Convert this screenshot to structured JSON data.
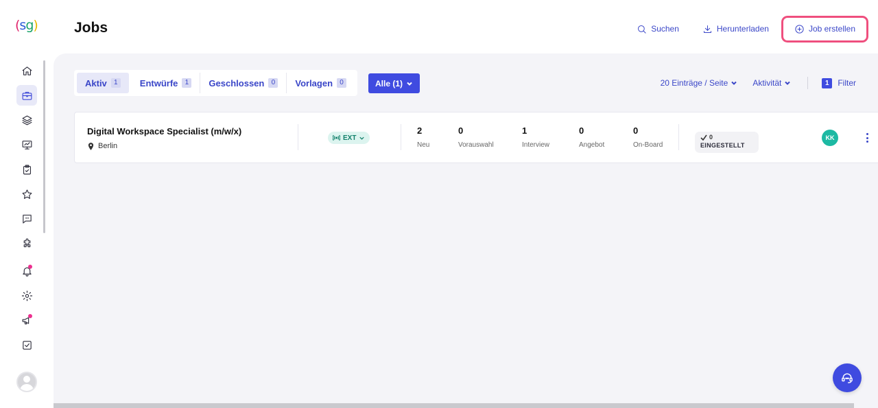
{
  "app": {
    "logo_text": "(sg)"
  },
  "header": {
    "title": "Jobs",
    "actions": {
      "search": "Suchen",
      "download": "Herunterladen",
      "create": "Job erstellen"
    }
  },
  "sidebar": {
    "items": [
      {
        "name": "home-icon"
      },
      {
        "name": "briefcase-icon",
        "active": true
      },
      {
        "name": "layers-icon"
      },
      {
        "name": "presentation-icon"
      },
      {
        "name": "clipboard-check-icon"
      },
      {
        "name": "star-icon"
      },
      {
        "name": "message-quote-icon"
      },
      {
        "name": "puzzle-icon"
      },
      {
        "name": "bell-icon",
        "notification": true
      },
      {
        "name": "gear-icon"
      },
      {
        "name": "megaphone-icon",
        "notification": true
      },
      {
        "name": "checkbox-icon"
      }
    ]
  },
  "tabs": [
    {
      "label": "Aktiv",
      "count": "1",
      "active": true
    },
    {
      "label": "Entwürfe",
      "count": "1"
    },
    {
      "label": "Geschlossen",
      "count": "0"
    },
    {
      "label": "Vorlagen",
      "count": "0"
    }
  ],
  "filter_bar": {
    "scope_button": "Alle (1)",
    "page_size": "20 Einträge / Seite",
    "sort": "Aktivität",
    "filter_count": "1",
    "filter_label": "Filter"
  },
  "job": {
    "title": "Digital Workspace Specialist (m/w/x)",
    "location": "Berlin",
    "tag": "EXT",
    "stats": [
      {
        "value": "2",
        "label": "Neu"
      },
      {
        "value": "0",
        "label": "Vorauswahl"
      },
      {
        "value": "1",
        "label": "Interview"
      },
      {
        "value": "0",
        "label": "Angebot"
      },
      {
        "value": "0",
        "label": "On-Board"
      }
    ],
    "hired_count": "0",
    "hired_label": "EINGESTELLT",
    "owner_initials": "KK"
  },
  "colors": {
    "accent": "#3f4be0",
    "highlight": "#ef4f7e",
    "ext_tag": "#12806b"
  }
}
